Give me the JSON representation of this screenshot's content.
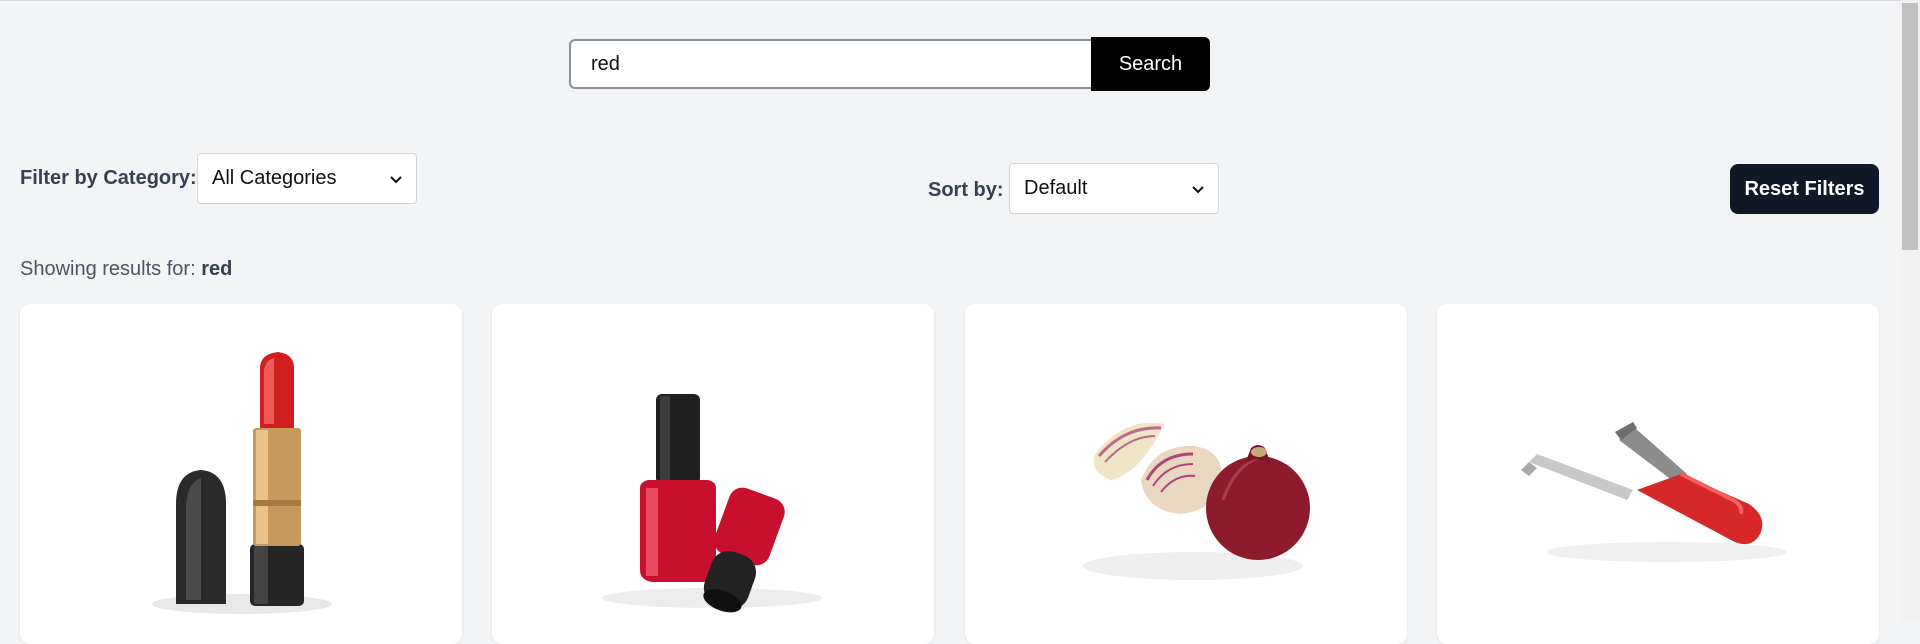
{
  "search": {
    "value": "red",
    "button_label": "Search"
  },
  "filters": {
    "category_label": "Filter by Category:",
    "category_selected": "All Categories",
    "sort_label": "Sort by:",
    "sort_selected": "Default",
    "reset_label": "Reset Filters"
  },
  "results": {
    "prefix": "Showing results for:",
    "query": "red"
  },
  "products": [
    {
      "icon": "lipstick-image"
    },
    {
      "icon": "nail-polish-image"
    },
    {
      "icon": "red-onion-image"
    },
    {
      "icon": "tongs-image"
    }
  ],
  "colors": {
    "accent_dark": "#111827",
    "search_button": "#000000",
    "background": "#f3f4f6"
  }
}
